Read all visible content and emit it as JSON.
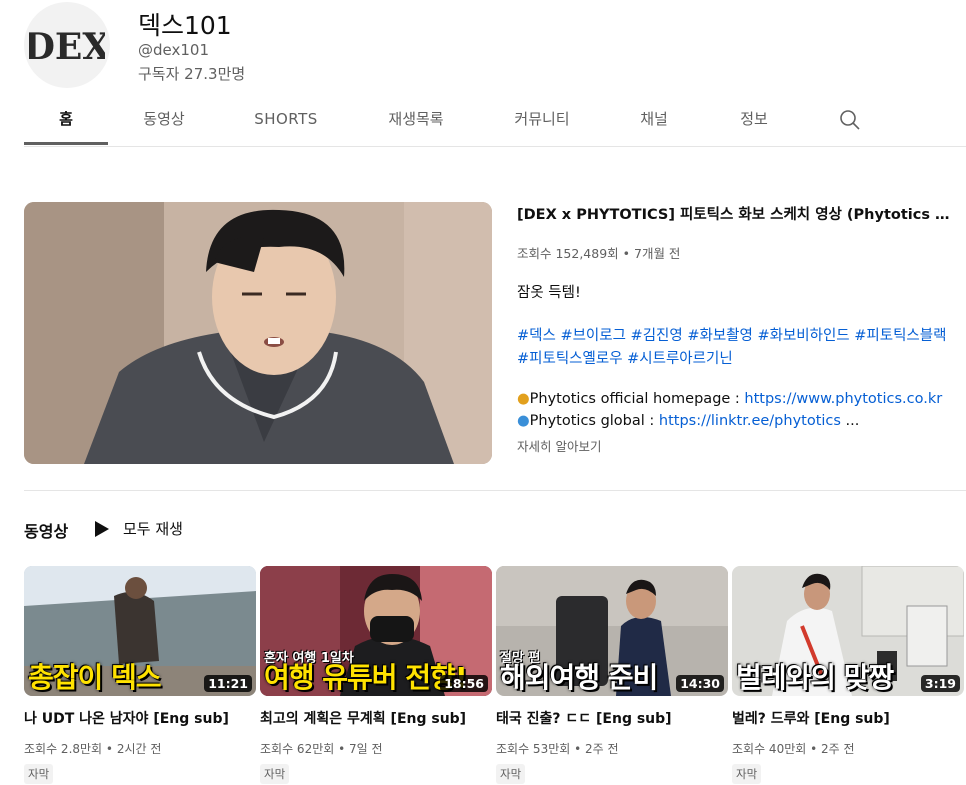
{
  "channel": {
    "name": "덱스101",
    "handle": "@dex101",
    "subscribers": "구독자 27.3만명",
    "logo_text": "DEX"
  },
  "tabs": [
    {
      "label": "홈",
      "active": true
    },
    {
      "label": "동영상"
    },
    {
      "label": "SHORTS"
    },
    {
      "label": "재생목록"
    },
    {
      "label": "커뮤니티"
    },
    {
      "label": "채널"
    },
    {
      "label": "정보"
    }
  ],
  "search_icon": "search-icon",
  "featured": {
    "title": "[DEX x PHYTOTICS] 피토틱스 화보 스케치 영상 (Phytotics Global Ambassador)",
    "views": "조회수 152,489회",
    "age": "7개월 전",
    "description_line1": "잠옷 득템!",
    "hashtags_line1": "#덱스 #브이로그 #김진영 #화보촬영 #화보비하인드 #피토틱스블랙",
    "hashtags_line2": "#피토틱스옐로우 #시트루아르기닌",
    "homepage_label": "Phytotics official homepage : ",
    "homepage_url": "https://www.phytotics.co.kr",
    "global_label": "Phytotics global : ",
    "global_url": "https://linktr.ee/phytotics",
    "ellipsis": " ...",
    "more": "자세히 알아보기"
  },
  "section": {
    "title": "동영상",
    "play_all": "모두 재생"
  },
  "videos": [
    {
      "title": "나 UDT 나온 남자야 [Eng sub]",
      "views": "조회수 2.8만회",
      "age": "2시간 전",
      "badge": "자막",
      "duration": "11:21",
      "overlay_big": "총잡이 덱스",
      "overlay_small": ""
    },
    {
      "title": "최고의 계획은 무계획 [Eng sub]",
      "views": "조회수 62만회",
      "age": "7일 전",
      "badge": "자막",
      "duration": "18:56",
      "overlay_big": "여행 유튜버 전향!",
      "overlay_small": "혼자 여행 1일차"
    },
    {
      "title": "태국 진출? ㄷㄷ [Eng sub]",
      "views": "조회수 53만회",
      "age": "2주 전",
      "badge": "자막",
      "duration": "14:30",
      "overlay_big": "해외여행 준비",
      "overlay_small": "절망 편"
    },
    {
      "title": "벌레? 드루와 [Eng sub]",
      "views": "조회수 40만회",
      "age": "2주 전",
      "badge": "자막",
      "duration": "3:19",
      "overlay_big": "벌레와의 맞짱",
      "overlay_small": ""
    }
  ],
  "meta_separator": " • "
}
